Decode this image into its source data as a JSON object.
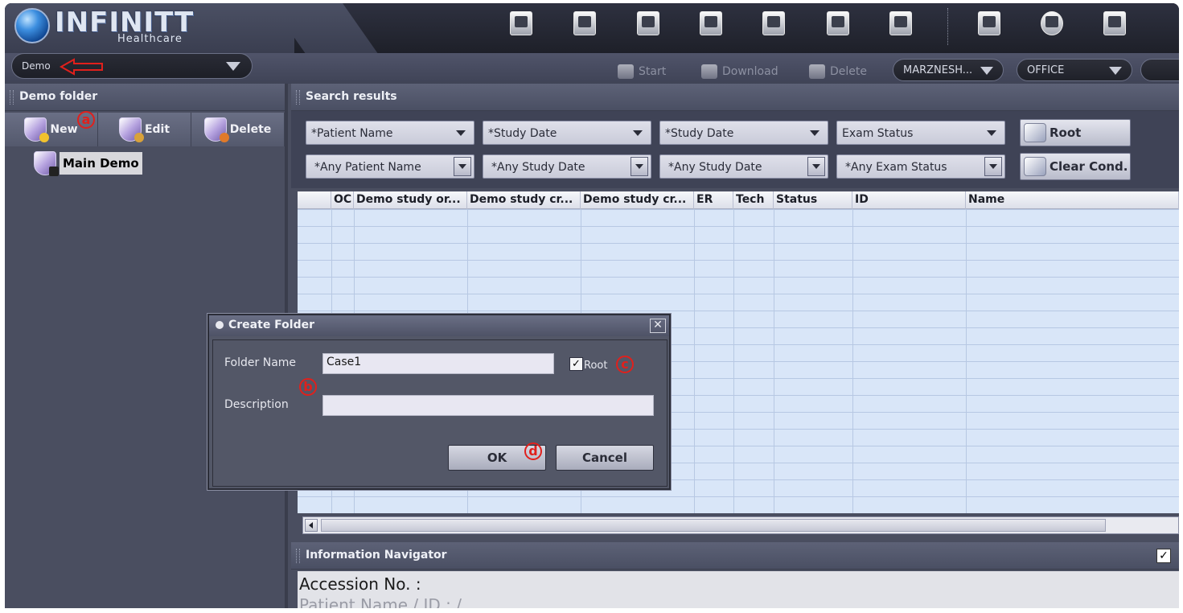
{
  "app": {
    "logo_text": "INFINITT",
    "logo_sub": "Healthcare"
  },
  "toolbar_icons": [
    "monitor-icon",
    "workstation-icon",
    "printer-icon",
    "user-monitor-icon",
    "open-folder-icon",
    "scanner-icon",
    "import-icon",
    "folder-icon",
    "settings-icon",
    "layout-icon"
  ],
  "demo_select": {
    "value": "Demo"
  },
  "actions": {
    "start": "Start",
    "download": "Download",
    "delete": "Delete"
  },
  "selectors": {
    "server": "MARZNESH...",
    "location": "OFFICE"
  },
  "left_panel": {
    "title": "Demo folder",
    "buttons": {
      "new": "New",
      "edit": "Edit",
      "delete": "Delete"
    },
    "tree": [
      {
        "label": "Main Demo"
      }
    ]
  },
  "search": {
    "title": "Search results",
    "filters_row1": [
      "*Patient Name",
      "*Study Date",
      "*Study Date",
      "Exam Status"
    ],
    "filters_row2": [
      "*Any Patient Name",
      "*Any Study Date",
      "*Any Study Date",
      "*Any Exam Status"
    ],
    "root_button": "Root",
    "clear_button": "Clear Cond.",
    "columns": [
      "",
      "OC",
      "Demo study or...",
      "Demo study cr...",
      "Demo study cr...",
      "ER",
      "Tech",
      "Status",
      "ID",
      "Name"
    ]
  },
  "info_navigator": {
    "title": "Information Navigator",
    "accession": "Accession No. :",
    "patient": "Patient Name / ID :   /",
    "checkbox_mark": "✓"
  },
  "dialog": {
    "title": "Create Folder",
    "close": "✕",
    "folder_name_label": "Folder Name",
    "folder_name_value": "Case1",
    "root_label": "Root",
    "root_checked_mark": "✓",
    "description_label": "Description",
    "description_value": "",
    "ok": "OK",
    "cancel": "Cancel"
  },
  "annotations": {
    "a": "a",
    "b": "b",
    "c": "c",
    "d": "d"
  },
  "colors": {
    "annotation_red": "#e0201c",
    "grid_bg": "#d9e6f8"
  }
}
